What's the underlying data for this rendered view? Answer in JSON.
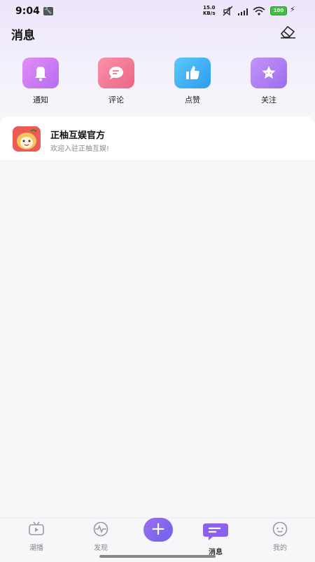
{
  "status_bar": {
    "time": "9:04",
    "speed_value": "15.0",
    "speed_unit": "KB/s",
    "battery": "100"
  },
  "header": {
    "title": "消息"
  },
  "categories": [
    {
      "label": "通知",
      "icon": "bell-icon",
      "color": "#c47cf0"
    },
    {
      "label": "评论",
      "icon": "comment-icon",
      "color": "#f07b96"
    },
    {
      "label": "点赞",
      "icon": "thumbs-up-icon",
      "color": "#3fb0f6"
    },
    {
      "label": "关注",
      "icon": "star-icon",
      "color": "#a47af0"
    }
  ],
  "messages": [
    {
      "title": "正柚互娱官方",
      "preview": "欢迎入驻正柚互娱!"
    }
  ],
  "bottom_nav": {
    "items": [
      {
        "label": "潮播",
        "icon": "tv-icon"
      },
      {
        "label": "发现",
        "icon": "pulse-icon"
      },
      {
        "label": "消息",
        "icon": "message-icon",
        "active": true
      },
      {
        "label": "我的",
        "icon": "smile-icon"
      }
    ],
    "fab_label": "+"
  }
}
